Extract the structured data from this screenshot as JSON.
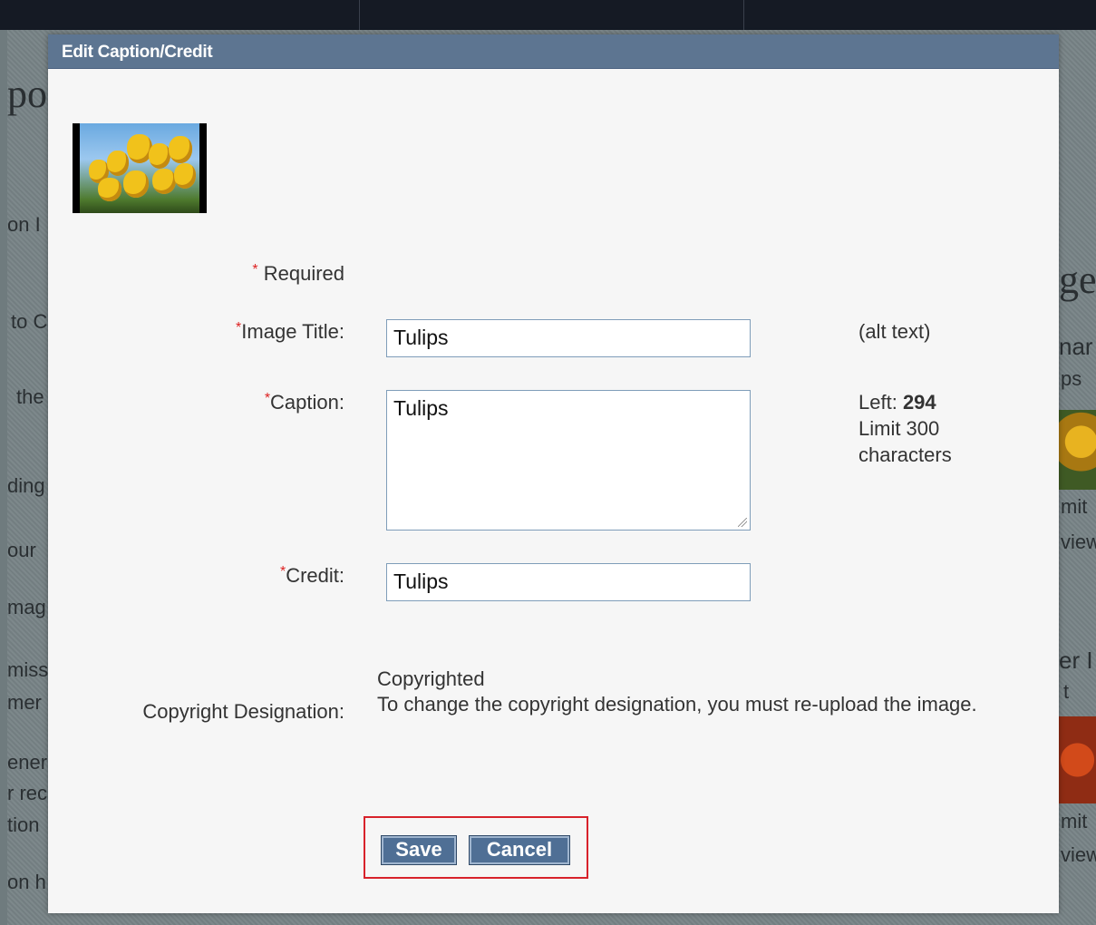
{
  "dialog": {
    "title": "Edit Caption/Credit",
    "required_note": "Required",
    "required_mark": "*",
    "image_title": {
      "label": "Image Title:",
      "value": "Tulips",
      "hint": "(alt text)"
    },
    "caption": {
      "label": "Caption:",
      "value": "Tulips",
      "left_label": "Left:",
      "left_count": "294",
      "limit_line1": "Limit 300",
      "limit_line2": "characters"
    },
    "credit": {
      "label": "Credit:",
      "value": "Tulips"
    },
    "copyright": {
      "label": "Copyright Designation:",
      "value": "Copyrighted",
      "note": "To change the copyright designation, you must re-upload the image."
    },
    "buttons": {
      "save": "Save",
      "cancel": "Cancel"
    }
  },
  "background": {
    "left_fragments": [
      "on I",
      "to C",
      "the",
      "ding",
      "our",
      "mag",
      "miss",
      "mer",
      "ener",
      "r rec",
      "tion",
      "on h"
    ],
    "heading_fragment": "po",
    "right_fragments": [
      "ge",
      "nar",
      "ps",
      "mit",
      "view",
      "er I",
      "t",
      "mit",
      "view"
    ]
  }
}
